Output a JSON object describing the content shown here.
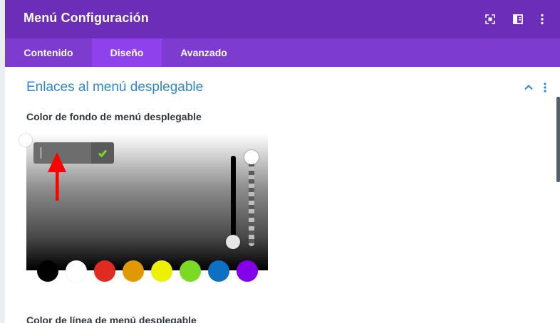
{
  "header": {
    "title": "Menú Configuración"
  },
  "tabs": [
    {
      "label": "Contenido",
      "active": false
    },
    {
      "label": "Diseño",
      "active": true
    },
    {
      "label": "Avanzado",
      "active": false
    }
  ],
  "section": {
    "title": "Enlaces al menú desplegable"
  },
  "fields": {
    "dropdown_bg_label": "Color de fondo de menú desplegable",
    "dropdown_line_label": "Color de línea de menú desplegable"
  },
  "color_picker": {
    "hex_value": "",
    "swatches": [
      "#000000",
      "#ffffff",
      "#e02b20",
      "#e09900",
      "#edf000",
      "#7cda24",
      "#0c71c3",
      "#8300e9"
    ]
  },
  "colors": {
    "header_bg": "#6c2eb9",
    "tabs_bg": "#7e3bd0",
    "active_tab_bg": "#8f42ec",
    "section_title": "#2b87da",
    "check": "#7cda24",
    "annotation_arrow": "#ff0000"
  },
  "icons": {
    "header": [
      "fullscreen-icon",
      "split-view-icon",
      "more-options-icon"
    ],
    "section": [
      "chevron-up-icon",
      "more-options-icon"
    ],
    "confirm": "check-icon"
  }
}
